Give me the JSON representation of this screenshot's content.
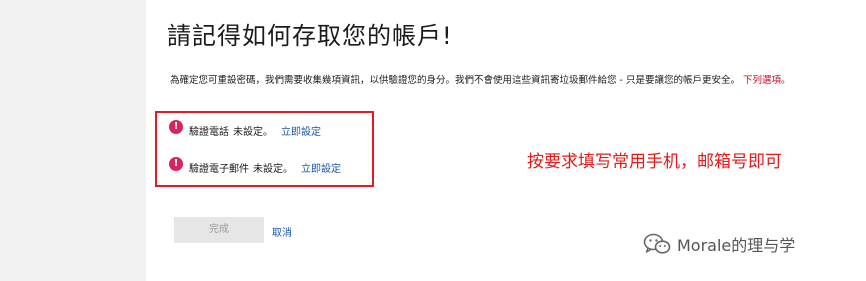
{
  "page": {
    "title": "請記得如何存取您的帳戶!",
    "description": "為確定您可重設密碼，我們需要收集幾項資訊，以供驗證您的身分。我們不會使用這些資訊寄垃圾郵件給您 - 只是要讓您的帳戶更安全。",
    "description_link": "下列選項。"
  },
  "verification": {
    "phone": {
      "label": "驗證電話",
      "status": "未設定。",
      "action": "立即設定",
      "icon": "alert-circle-icon",
      "icon_glyph": "!"
    },
    "email": {
      "label": "驗證電子郵件",
      "status": "未設定。",
      "action": "立即設定",
      "icon": "alert-circle-icon",
      "icon_glyph": "!"
    }
  },
  "annotation": {
    "text": "按要求填写常用手机，邮箱号即可",
    "color": "#e21b1b"
  },
  "footer": {
    "done_label": "完成",
    "cancel_label": "取消"
  },
  "watermark": {
    "text": "Morale的理与学",
    "icon": "wechat-icon"
  },
  "colors": {
    "warning": "#d8245d",
    "link": "#1a56a8",
    "highlight_border": "#e01b22"
  }
}
